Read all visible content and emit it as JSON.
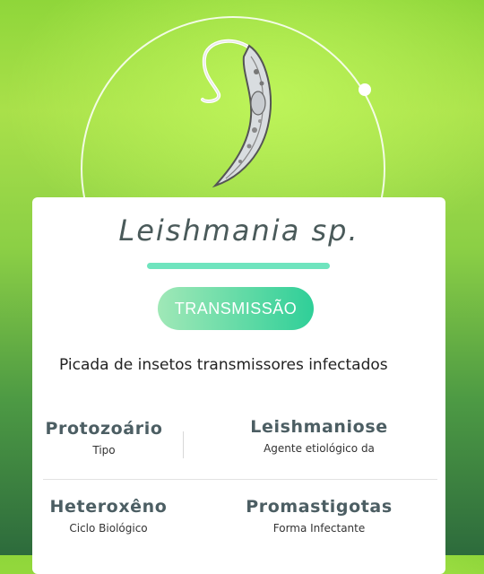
{
  "creature": {
    "name": "Leishmania  sp.",
    "image_icon": "parasite-illustration-icon"
  },
  "transmission_button": {
    "label": "TRANSMISSÃO"
  },
  "description": "Picada de insetos transmissores infectados",
  "stats": [
    {
      "value": "Protozoário",
      "label": "Tipo"
    },
    {
      "value": "Leishmaniose",
      "label": "Agente etiológico da"
    },
    {
      "value": "Heteroxêno",
      "label": "Ciclo Biológico"
    },
    {
      "value": "Promastigotas",
      "label": "Forma Infectante"
    }
  ],
  "colors": {
    "accent": "#6fe4be",
    "button_start": "#a0e8b7",
    "button_end": "#2fcf98",
    "stat_text": "#4c5e63"
  }
}
